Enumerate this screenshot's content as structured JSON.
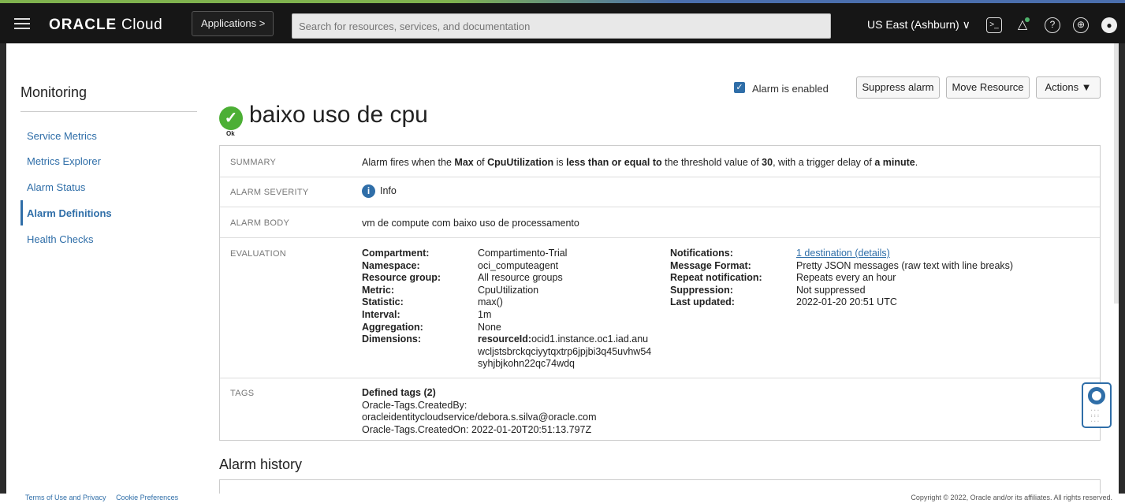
{
  "topbar": {
    "brand_bold": "ORACLE",
    "brand_rest": " Cloud",
    "applications_label": "Applications >",
    "search_placeholder": "Search for resources, services, and documentation",
    "region_label": "US East (Ashburn) ∨",
    "icons": [
      "menu-icon",
      "cloud-shell-icon",
      "bell-icon",
      "help-icon",
      "globe-icon",
      "profile-icon"
    ]
  },
  "sidebar": {
    "title": "Monitoring",
    "items": [
      {
        "label": "Service Metrics",
        "active": false
      },
      {
        "label": "Metrics Explorer",
        "active": false
      },
      {
        "label": "Alarm Status",
        "active": false
      },
      {
        "label": "Alarm Definitions",
        "active": true
      },
      {
        "label": "Health Checks",
        "active": false
      }
    ]
  },
  "actions": {
    "alarm_enabled_label": "Alarm is enabled",
    "suppress_label": "Suppress alarm",
    "move_label": "Move Resource",
    "actions_label": "Actions ▼"
  },
  "alarm": {
    "status": "Ok",
    "name": "baixo uso de cpu"
  },
  "details": {
    "summary_label": "SUMMARY",
    "summary": {
      "p1": "Alarm fires when the ",
      "b1": "Max",
      "p2": " of ",
      "b2": "CpuUtilization",
      "p3": " is ",
      "b3": "less than or equal to",
      "p4": " the threshold value of ",
      "b4": "30",
      "p5": ", with a trigger delay of ",
      "b5": "a minute",
      "p6": "."
    },
    "severity_label": "ALARM SEVERITY",
    "severity": "Info",
    "body_label": "ALARM BODY",
    "body": "vm de compute com baixo uso de processamento",
    "evaluation_label": "EVALUATION",
    "evaluation": {
      "compartment_k": "Compartment:",
      "compartment_v": "Compartimento-Trial",
      "namespace_k": "Namespace:",
      "namespace_v": "oci_computeagent",
      "resource_group_k": "Resource group:",
      "resource_group_v": "All resource groups",
      "metric_k": "Metric:",
      "metric_v": "CpuUtilization",
      "statistic_k": "Statistic:",
      "statistic_v": "max()",
      "interval_k": "Interval:",
      "interval_v": "1m",
      "aggregation_k": "Aggregation:",
      "aggregation_v": "None",
      "dimensions_k": "Dimensions:",
      "dimensions_key": "resourceId:",
      "dimensions_l1": "ocid1.instance.oc1.iad.anu",
      "dimensions_l2": "wcljstsbrckqciyytqxtrp6jpjbi3q45uvhw54",
      "dimensions_l3": "syhjbjkohn22qc74wdq",
      "notifications_k": "Notifications:",
      "notifications_v": "1 destination (details)",
      "message_format_k": "Message Format:",
      "message_format_v": "Pretty JSON messages (raw text with line breaks)",
      "repeat_k": "Repeat notification:",
      "repeat_v": "Repeats every an hour",
      "suppression_k": "Suppression:",
      "suppression_v": "Not suppressed",
      "last_updated_k": "Last updated:",
      "last_updated_v": "2022-01-20 20:51 UTC"
    },
    "tags_label": "TAGS",
    "tags": {
      "heading": "Defined tags (2)",
      "l1": "Oracle-Tags.CreatedBy:",
      "l2": "oracleidentitycloudservice/debora.s.silva@oracle.com",
      "l3": "Oracle-Tags.CreatedOn: 2022-01-20T20:51:13.797Z"
    }
  },
  "history": {
    "title": "Alarm history"
  },
  "footer": {
    "terms": "Terms of Use and Privacy",
    "cookies": "Cookie Preferences",
    "copyright": "Copyright © 2022, Oracle and/or its affiliates. All rights reserved."
  }
}
